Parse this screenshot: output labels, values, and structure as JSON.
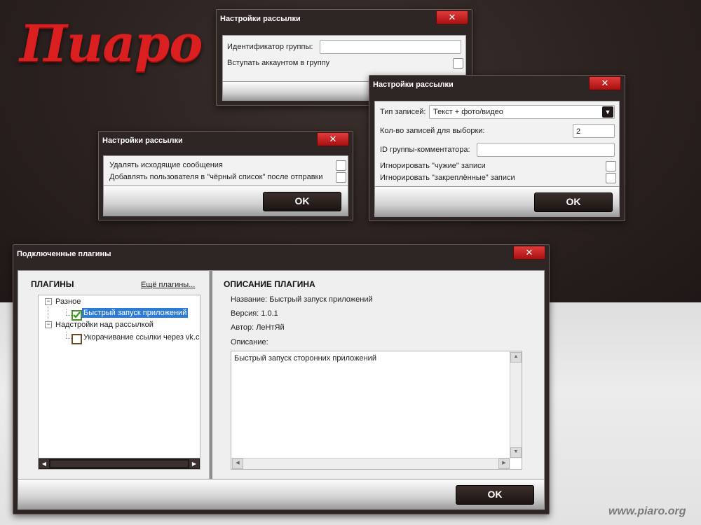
{
  "brand": {
    "logo_text": "Пиаро",
    "footer_url": "www.piaro.org"
  },
  "colors": {
    "accent_red": "#d91f1f",
    "dark_bg": "#2b2220",
    "selection_blue": "#2e7bd6"
  },
  "icons": {
    "close": "close-icon",
    "combo": "chevron-down-icon",
    "expand": "expander-icon"
  },
  "dialog_group": {
    "title": "Настройки рассылки",
    "close_glyph": "✕",
    "group_id_label": "Идентификатор группы:",
    "group_id_value": "",
    "join_label": "Вступать аккаунтом в группу"
  },
  "dialog_messages": {
    "title": "Настройки рассылки",
    "close_glyph": "✕",
    "delete_outgoing_label": "Удалять исходящие сообщения",
    "blacklist_label": "Добавлять пользователя в \"чёрный список\" после отправки",
    "ok_label": "OK"
  },
  "dialog_posts": {
    "title": "Настройки рассылки",
    "close_glyph": "✕",
    "post_type_label": "Тип записей:",
    "post_type_value": "Текст + фото/видео",
    "count_label": "Кол-во записей для выборки:",
    "count_value": "2",
    "commenter_id_label": "ID группы-комментатора:",
    "commenter_id_value": "",
    "ignore_foreign_label": "Игнорировать \"чужие\" записи",
    "ignore_pinned_label": "Игнорировать \"закреплённые\" записи",
    "ok_label": "OK"
  },
  "dialog_plugins": {
    "title": "Подключенные плагины",
    "close_glyph": "✕",
    "plugins_heading": "ПЛАГИНЫ",
    "more_plugins_link": "Ещё плагины...",
    "tree": {
      "group1": "Разное",
      "group1_item": "Быстрый запуск приложений",
      "group2": "Надстройки над рассылкой",
      "group2_item": "Укорачивание ссылки через vk.c"
    },
    "description_heading": "ОПИСАНИЕ ПЛАГИНА",
    "name_line": "Название: Быстрый запуск приложений",
    "version_line": "Версия: 1.0.1",
    "author_line": "Автор: ЛеНтЯй",
    "description_label": "Описание:",
    "description_text": "Быстрый запуск сторонних приложений",
    "ok_label": "OK"
  }
}
